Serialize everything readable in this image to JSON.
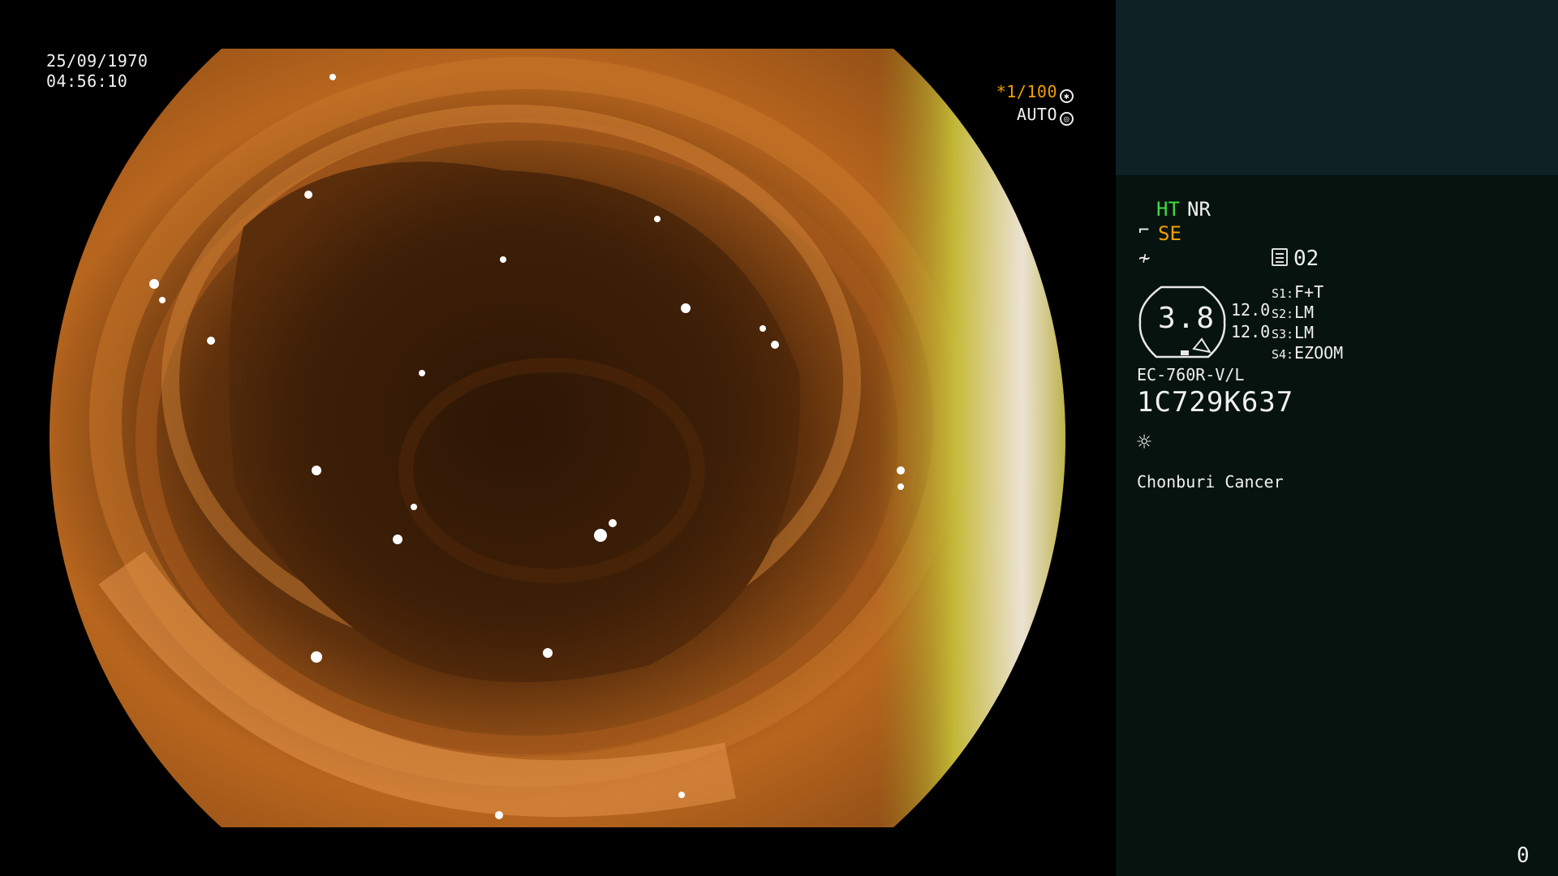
{
  "video": {
    "date": "25/09/1970",
    "time": "04:56:10",
    "shutter_value": "*1/100",
    "shutter_icon": "shutter-icon",
    "iris_mode": "AUTO",
    "iris_icon": "iris-icon"
  },
  "panel": {
    "ht": "HT",
    "nr": "NR",
    "se": "SE",
    "se_icon": "structure-enhance-icon",
    "fx_icon": "color-mode-icon",
    "memory_icon": "memory-icon",
    "memory_value": "02",
    "zoom_value": "3.8",
    "value_1": "12.0",
    "value_2": "12.0",
    "switches": [
      {
        "label": "S1:",
        "value": "F+T"
      },
      {
        "label": "S2:",
        "value": "LM"
      },
      {
        "label": "S3:",
        "value": "LM"
      },
      {
        "label": "S4:",
        "value": "EZOOM"
      }
    ],
    "scope_model": "EC-760R-V/L",
    "scope_serial": "1C729K637",
    "light_icon": "light-sun-icon",
    "hospital": "Chonburi Cancer",
    "counter": "0"
  },
  "colors": {
    "panel_bg": "#06130f",
    "panel_top": "#0d2223",
    "ht_green": "#3ddc3d",
    "se_orange": "#f0a000"
  }
}
